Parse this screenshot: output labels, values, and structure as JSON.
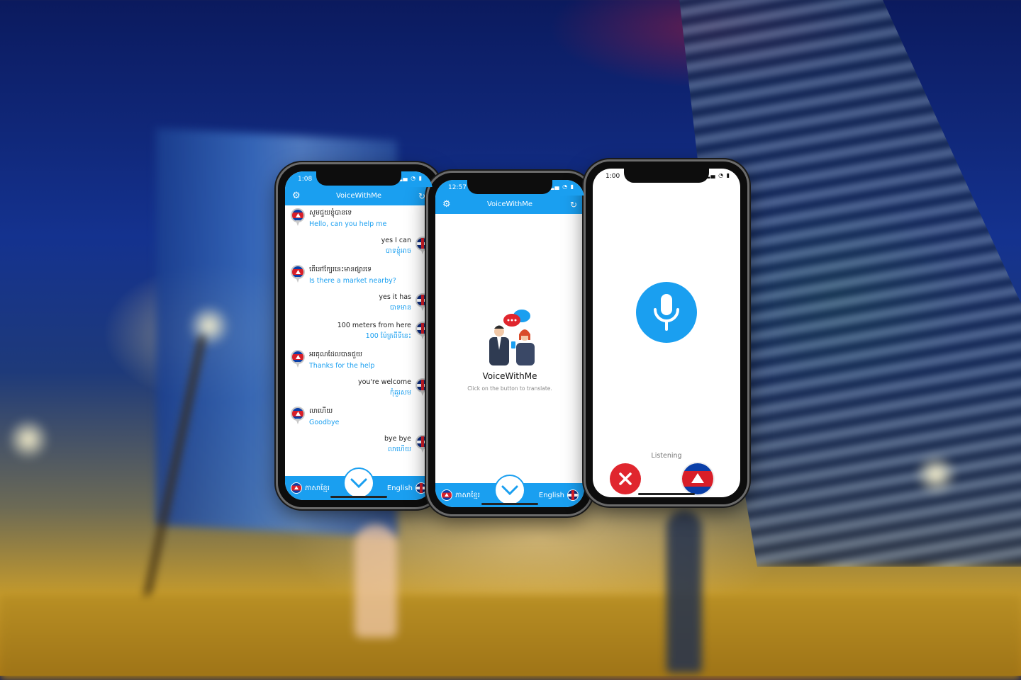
{
  "phone_left": {
    "time": "1:08",
    "app_title": "VoiceWithMe",
    "messages": [
      {
        "side": "left",
        "flag": "kh",
        "original": "សូមជួយខ្ញុំបានទេ",
        "translation": "Hello, can you help me"
      },
      {
        "side": "right",
        "flag": "uk",
        "original": "yes I can",
        "translation": "បាទខ្ញុំអាច"
      },
      {
        "side": "left",
        "flag": "kh",
        "original": "តើនៅក្បែរនេះមានផ្សារទេ",
        "translation": "Is there a market nearby?"
      },
      {
        "side": "right",
        "flag": "uk",
        "original": "yes it has",
        "translation": "បាទមាន"
      },
      {
        "side": "right",
        "flag": "uk",
        "original": "100 meters from here",
        "translation": "100 ម៉ែត្រពីទីនេះ"
      },
      {
        "side": "left",
        "flag": "kh",
        "original": "អរគុណដែលបានជួយ",
        "translation": "Thanks for the help"
      },
      {
        "side": "right",
        "flag": "uk",
        "original": "you're welcome",
        "translation": "កុំគួរសម"
      },
      {
        "side": "left",
        "flag": "kh",
        "original": "លាហើយ",
        "translation": "Goodbye"
      },
      {
        "side": "right",
        "flag": "uk",
        "original": "bye bye",
        "translation": "លាហើយ"
      }
    ],
    "lang_left": "ភាសាខ្មែរ",
    "lang_right": "English"
  },
  "phone_center": {
    "time": "12:57",
    "app_title": "VoiceWithMe",
    "brand": "VoiceWithMe",
    "hint": "Click on the button to translate.",
    "lang_left": "ភាសាខ្មែរ",
    "lang_right": "English"
  },
  "phone_right": {
    "time": "1:00",
    "status": "Listening"
  },
  "icons": [
    "gear-icon",
    "refresh-icon",
    "chevron-down-icon",
    "microphone-icon",
    "close-icon",
    "cambodia-flag-icon",
    "uk-flag-icon"
  ],
  "colors": {
    "accent": "#1a9ff0",
    "cancel": "#e0262e"
  }
}
